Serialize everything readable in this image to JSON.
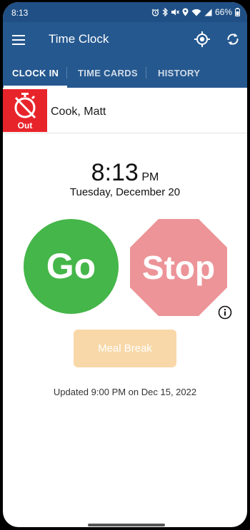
{
  "status_bar": {
    "time": "8:13",
    "battery": "66%",
    "icons": [
      "alarm-icon",
      "bluetooth-icon",
      "mute-icon",
      "location-icon",
      "wifi-icon",
      "signal-icon",
      "battery-icon"
    ]
  },
  "app_bar": {
    "title": "Time Clock",
    "icons": [
      "menu-icon",
      "gps-target-icon",
      "sync-icon"
    ]
  },
  "tabs": [
    {
      "label": "CLOCK IN",
      "active": true
    },
    {
      "label": "TIME CARDS",
      "active": false
    },
    {
      "label": "HISTORY",
      "active": false
    }
  ],
  "employee": {
    "name": "Cook, Matt",
    "status": "Out",
    "status_color": "#e8242b"
  },
  "clock": {
    "time": "8:13",
    "ampm": "PM",
    "date": "Tuesday, December 20"
  },
  "actions": {
    "go_label": "Go",
    "go_color": "#45b649",
    "stop_label": "Stop",
    "stop_color": "#ec9498",
    "meal_break_label": "Meal Break",
    "meal_break_color": "#f8d8a8"
  },
  "footer": {
    "updated": "Updated 9:00 PM on Dec 15, 2022"
  },
  "colors": {
    "primary": "#25588f",
    "status_bar": "#1f4f85"
  }
}
